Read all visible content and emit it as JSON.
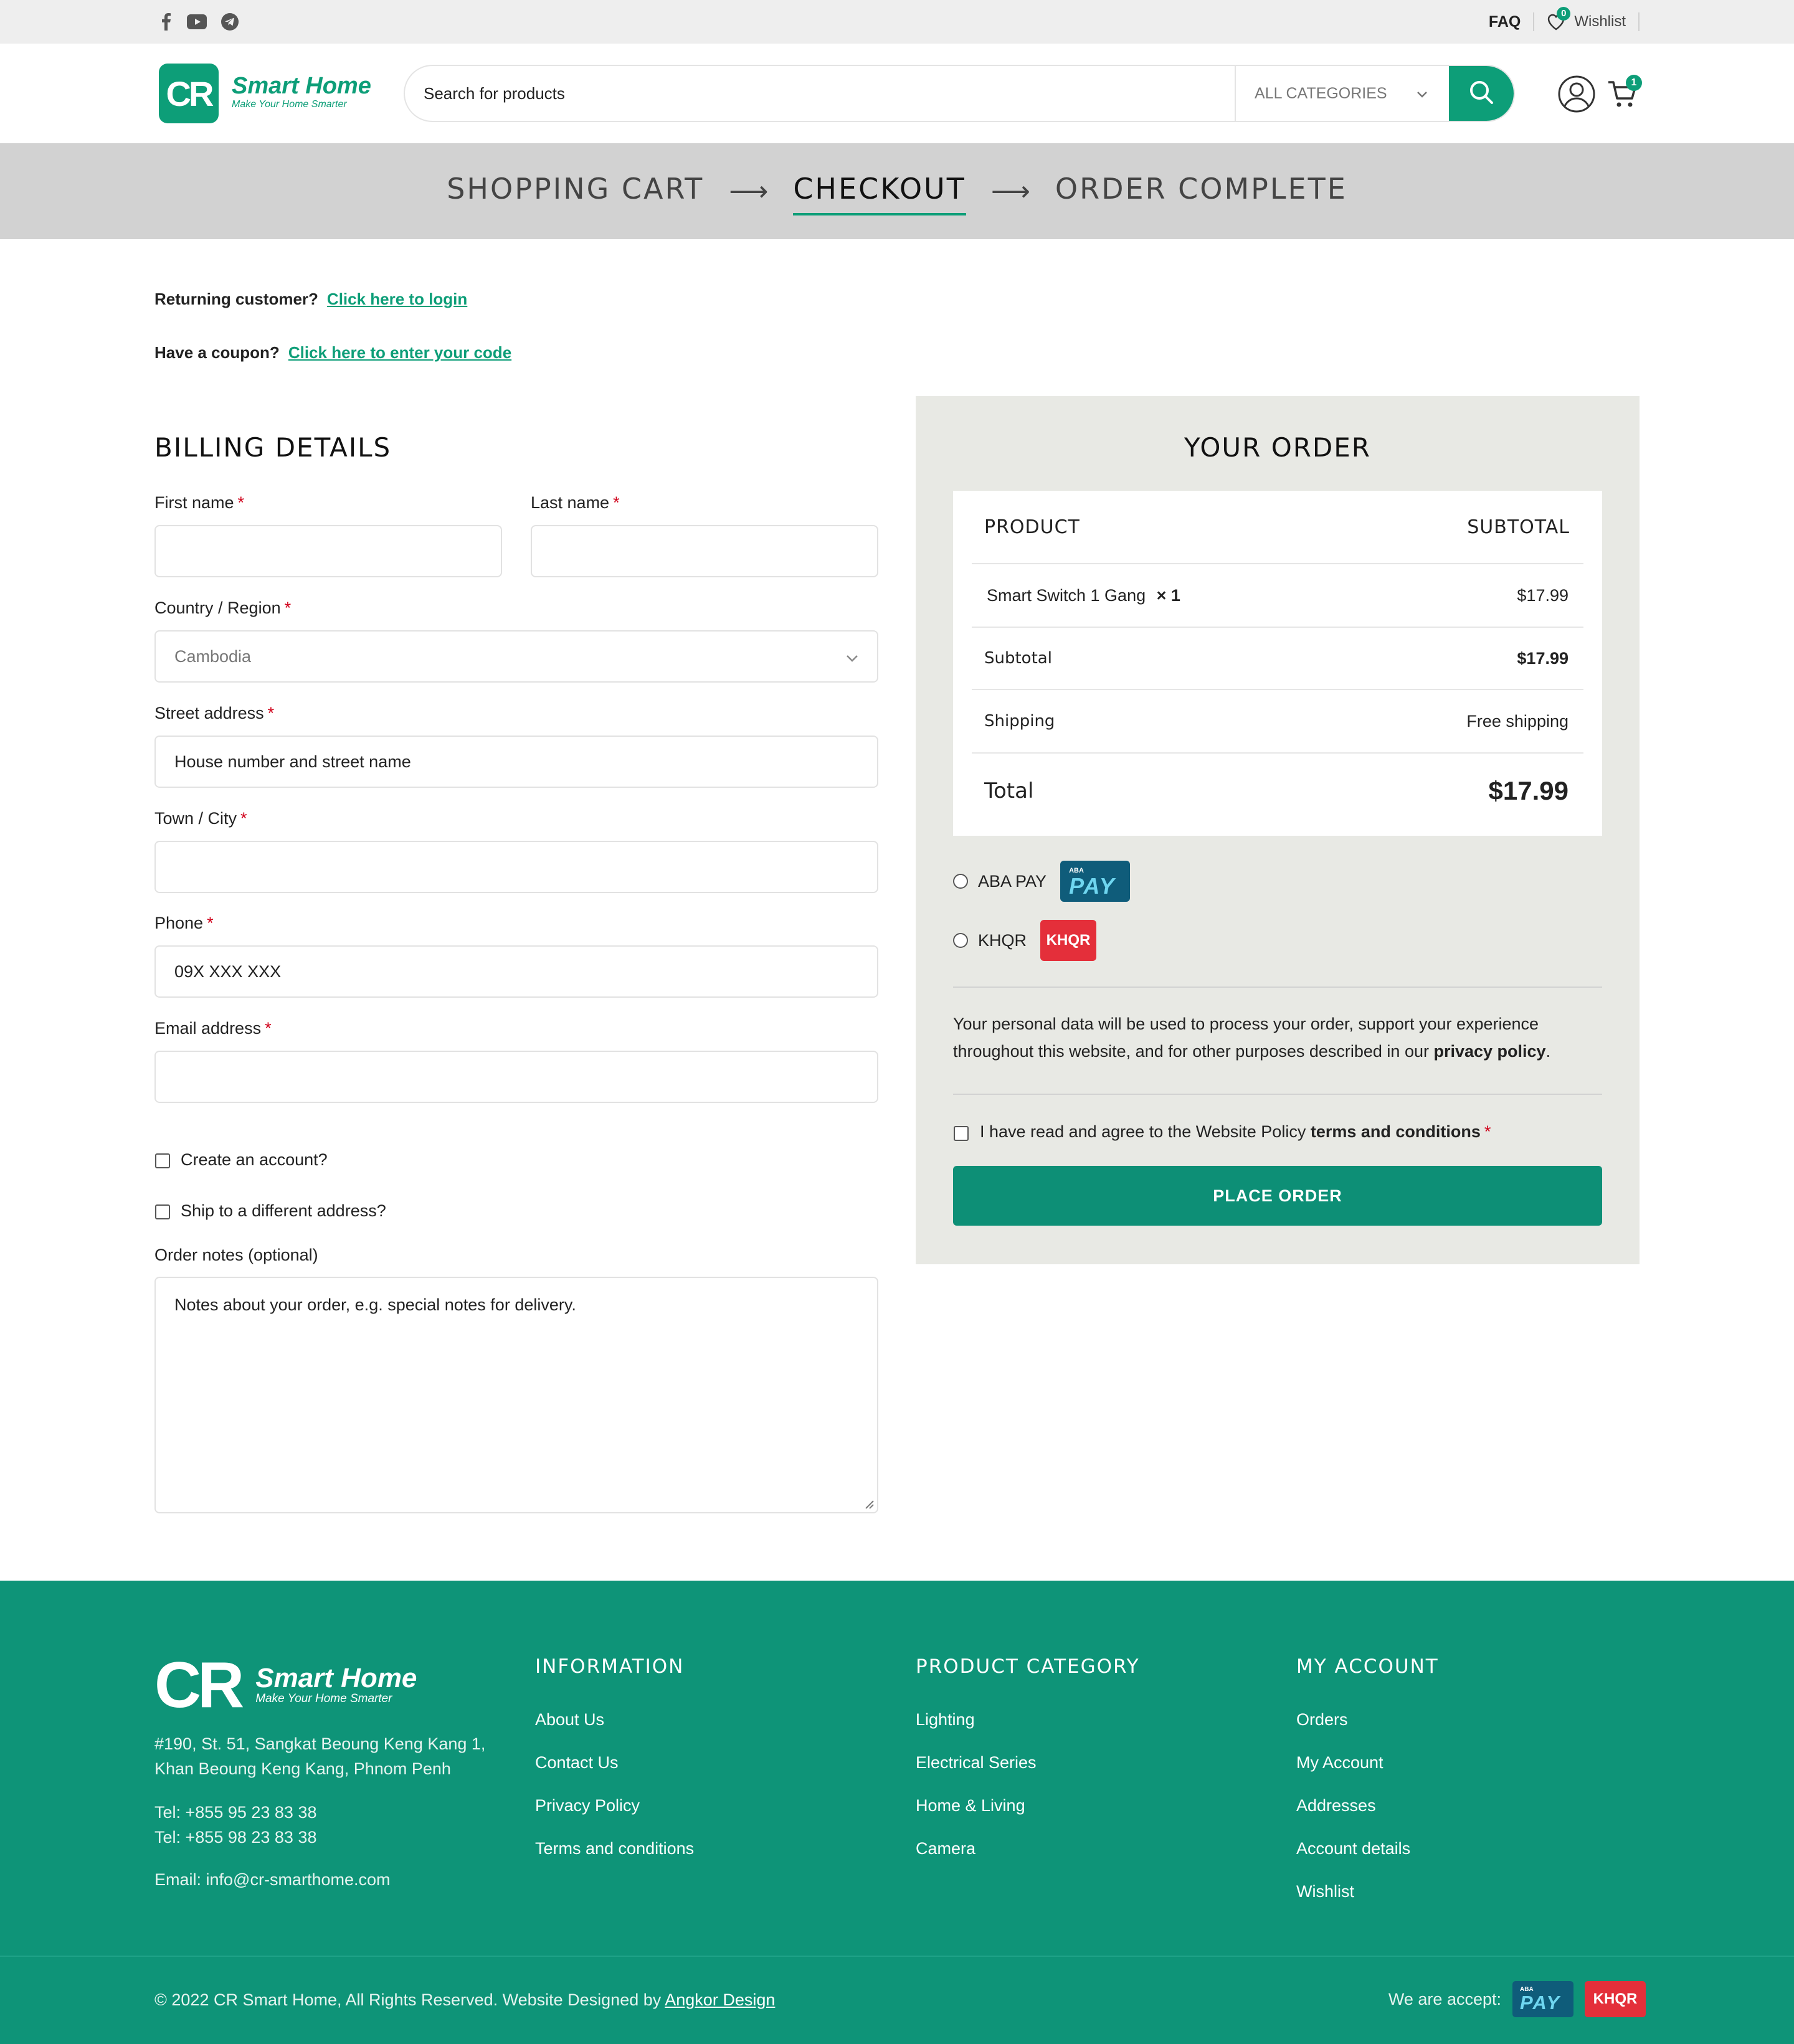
{
  "topbar": {
    "faq": "FAQ",
    "wishlist": "Wishlist",
    "wishlist_count": "0"
  },
  "header": {
    "logo_mark": "CR",
    "logo_name": "Smart Home",
    "logo_tagline": "Make Your Home Smarter",
    "search_placeholder": "Search for products",
    "category": "ALL CATEGORIES",
    "cart_count": "1"
  },
  "steps": {
    "cart": "SHOPPING CART",
    "checkout": "CHECKOUT",
    "complete": "ORDER COMPLETE"
  },
  "notices": {
    "returning": "Returning customer?",
    "login_link": "Click here to login",
    "coupon": "Have a coupon?",
    "coupon_link": "Click here to enter your code"
  },
  "billing": {
    "title": "BILLING DETAILS",
    "first_name": "First name",
    "last_name": "Last name",
    "country": "Country / Region",
    "country_value": "Cambodia",
    "street": "Street address",
    "street_placeholder": "House number and street name",
    "city": "Town / City",
    "phone": "Phone",
    "phone_placeholder": "09X XXX XXX",
    "email": "Email address",
    "required_mark": "*",
    "create_account": "Create an account?",
    "ship_different": "Ship to a different address?",
    "notes_label": "Order notes (optional)",
    "notes_placeholder": "Notes about your order, e.g. special notes for delivery."
  },
  "order": {
    "title": "YOUR ORDER",
    "col_product": "PRODUCT",
    "col_subtotal": "SUBTOTAL",
    "item_name": "Smart Switch 1 Gang",
    "item_qty": "× 1",
    "item_price": "$17.99",
    "subtotal_label": "Subtotal",
    "subtotal_value": "$17.99",
    "shipping_label": "Shipping",
    "shipping_value": "Free shipping",
    "total_label": "Total",
    "total_value": "$17.99",
    "payments": [
      {
        "label": "ABA PAY",
        "logo_small": "ABA",
        "logo_big": "PAY"
      },
      {
        "label": "KHQR",
        "logo_big": "KHQR"
      }
    ],
    "privacy_text": "Your personal data will be used to process your order, support your experience throughout this website, and for other purposes described in our",
    "privacy_link": "privacy policy",
    "terms_text": "I have read and agree to the Website Policy",
    "terms_link": "terms and conditions",
    "place_order": "PLACE ORDER"
  },
  "footer": {
    "logo_mark": "CR",
    "logo_name": "Smart Home",
    "logo_tagline": "Make Your Home Smarter",
    "address_1": "#190, St. 51, Sangkat Beoung Keng Kang 1,",
    "address_2": "Khan Beoung Keng Kang, Phnom Penh",
    "tel_1": "Tel: +855 95 23 83 38",
    "tel_2": "Tel: +855 98 23 83 38",
    "email": "Email: info@cr-smarthome.com",
    "columns": [
      {
        "title": "INFORMATION",
        "links": [
          "About Us",
          "Contact Us",
          "Privacy Policy",
          "Terms and conditions"
        ]
      },
      {
        "title": "PRODUCT CATEGORY",
        "links": [
          "Lighting",
          "Electrical Series",
          "Home & Living",
          "Camera"
        ]
      },
      {
        "title": "MY ACCOUNT",
        "links": [
          "Orders",
          "My Account",
          "Addresses",
          "Account details",
          "Wishlist"
        ]
      }
    ],
    "copyright": "© 2022 CR Smart Home, All Rights Reserved. Website Designed by",
    "designer": "Angkor Design",
    "accept": "We are accept:"
  },
  "colors": {
    "brand": "#0d9e78",
    "price_red": "#cf1f2e",
    "footer_bg": "#0e9478"
  }
}
